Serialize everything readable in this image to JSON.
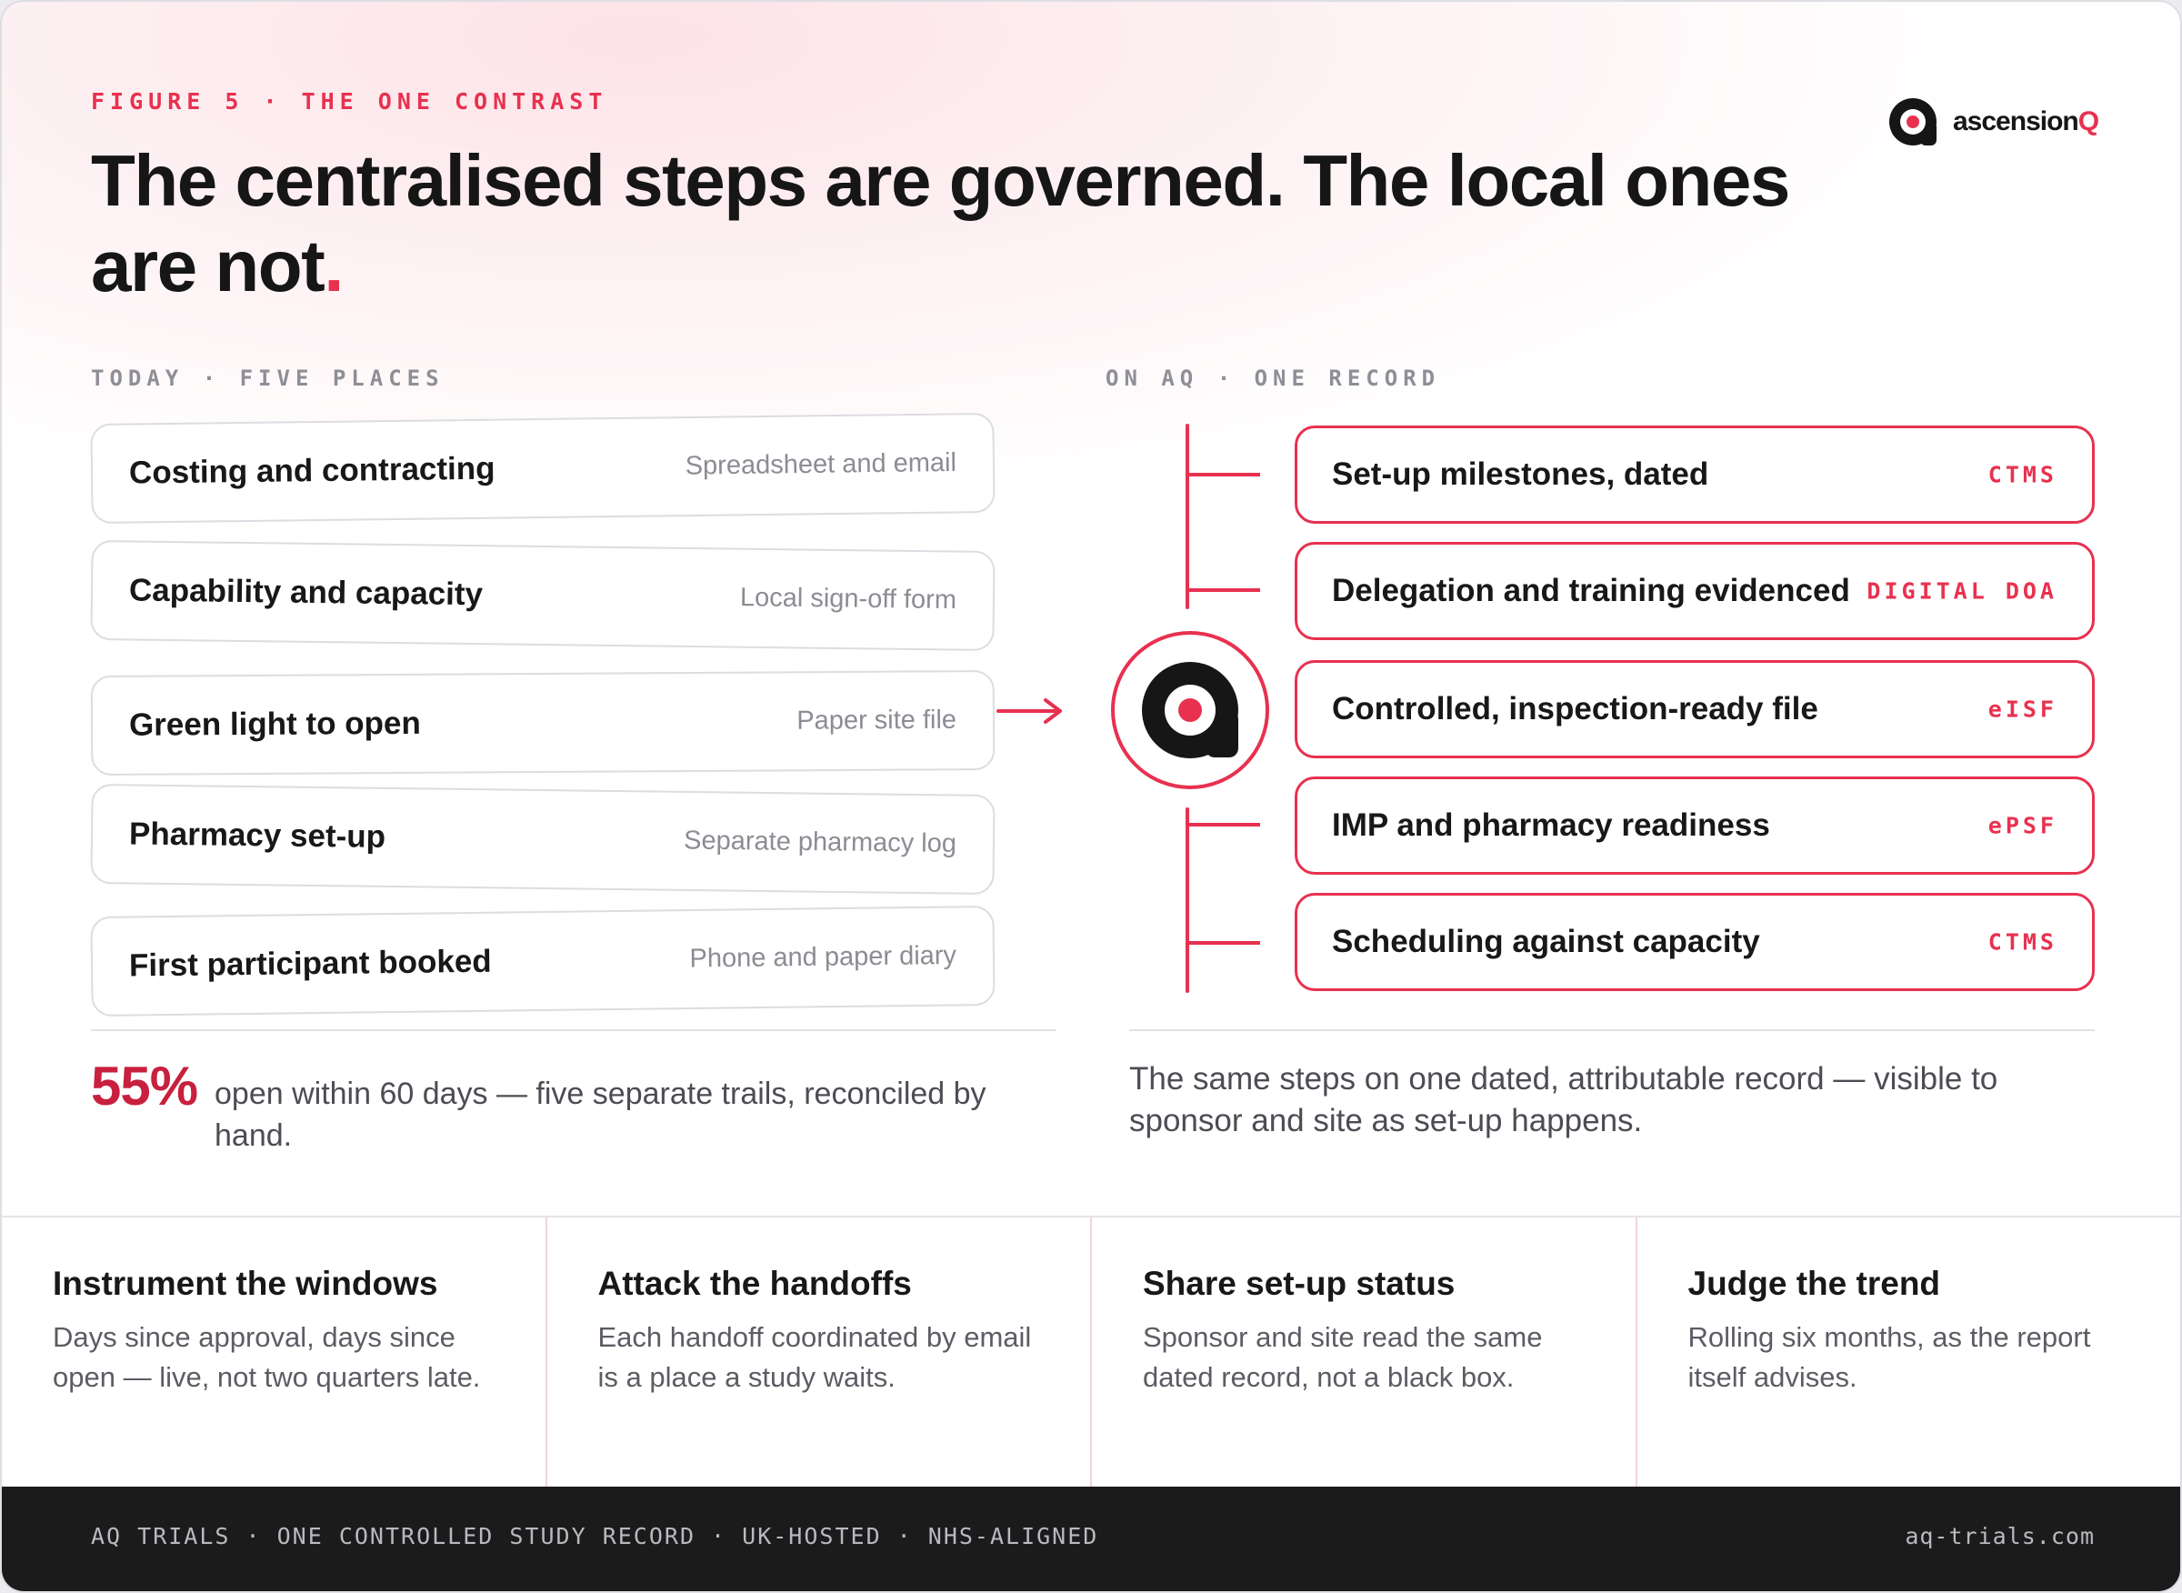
{
  "header": {
    "eyebrow": "FIGURE 5 · THE ONE CONTRAST",
    "title": "The centralised steps are governed. The local ones are not",
    "title_dot": "."
  },
  "logo": {
    "text_main": "ascension",
    "text_accent": "Q"
  },
  "today": {
    "label": "TODAY · FIVE PLACES",
    "steps": [
      {
        "name": "Costing and contracting",
        "source": "Spreadsheet and email"
      },
      {
        "name": "Capability and capacity",
        "source": "Local sign-off form"
      },
      {
        "name": "Green light to open",
        "source": "Paper site file"
      },
      {
        "name": "Pharmacy set-up",
        "source": "Separate pharmacy log"
      },
      {
        "name": "First participant booked",
        "source": "Phone and paper diary"
      }
    ],
    "stat_value": "55%",
    "stat_text": "open within 60 days — five separate trails, reconciled by hand."
  },
  "aq": {
    "label": "ON AQ · ONE RECORD",
    "steps": [
      {
        "name": "Set-up milestones, dated",
        "tag": "CTMS"
      },
      {
        "name": "Delegation and training evidenced",
        "tag": "DIGITAL DOA"
      },
      {
        "name": "Controlled, inspection-ready file",
        "tag": "eISF"
      },
      {
        "name": "IMP and pharmacy readiness",
        "tag": "ePSF"
      },
      {
        "name": "Scheduling against capacity",
        "tag": "CTMS"
      }
    ],
    "summary": "The same steps on one dated, attributable record — visible to sponsor and site as set-up happens."
  },
  "pillars": [
    {
      "heading": "Instrument the windows",
      "body": "Days since approval, days since open — live, not two quarters late."
    },
    {
      "heading": "Attack the handoffs",
      "body": "Each handoff coordinated by email is a place a study waits."
    },
    {
      "heading": "Share set-up status",
      "body": "Sponsor and site read the same dated record, not a black box."
    },
    {
      "heading": "Judge the trend",
      "body": "Rolling six months, as the report itself advises."
    }
  ],
  "footer": {
    "left": "AQ TRIALS · ONE CONTROLLED STUDY RECORD · UK-HOSTED · NHS-ALIGNED",
    "right": "aq-trials.com"
  },
  "colors": {
    "accent": "#e8314f",
    "stat": "#c8203e",
    "ink": "#18181b",
    "footer_bg": "#1b1b1c"
  },
  "icons": {
    "logo": "aq-logo-icon",
    "arrow": "arrow-right-icon",
    "hub": "aq-hub-icon"
  }
}
